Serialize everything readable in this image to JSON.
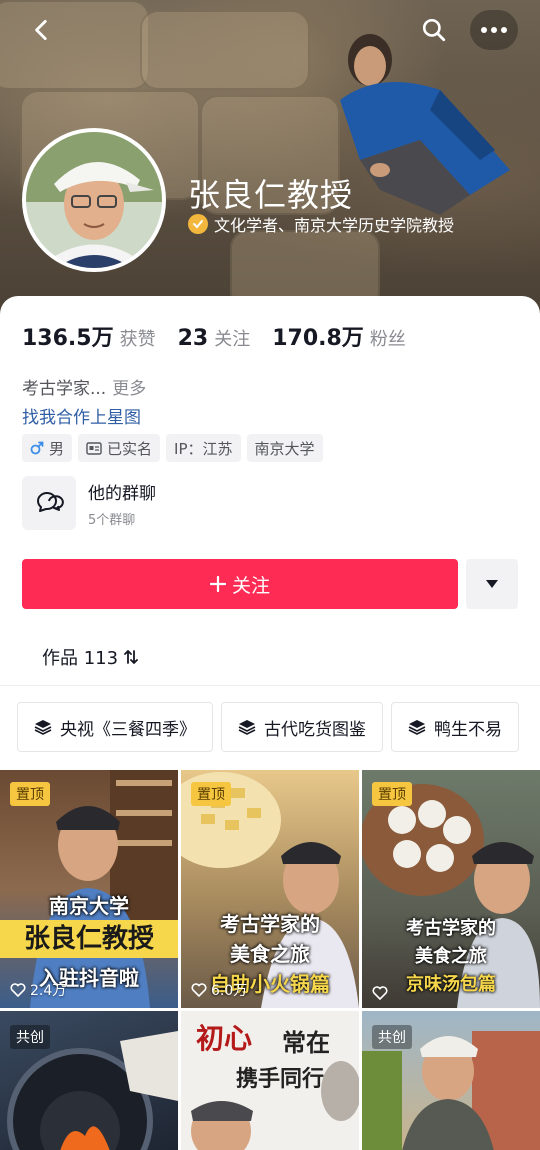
{
  "header": {
    "back_icon": "chevron-left-icon",
    "search_icon": "search-icon",
    "more_icon": "more-dots-icon"
  },
  "profile": {
    "name": "张良仁教授",
    "verification": "文化学者、南京大学历史学院教授",
    "stats": [
      {
        "value": "136.5万",
        "label": "获赞"
      },
      {
        "value": "23",
        "label": "关注"
      },
      {
        "value": "170.8万",
        "label": "粉丝"
      }
    ],
    "bio": "考古学家...",
    "bio_more": "更多",
    "bio_link": "找我合作上星图",
    "tags": [
      {
        "icon": "male-icon",
        "label": "男"
      },
      {
        "icon": "id-card-icon",
        "label": "已实名"
      },
      {
        "icon": "",
        "label": "IP：江苏"
      },
      {
        "icon": "",
        "label": "南京大学"
      }
    ],
    "group_chat": {
      "title": "他的群聊",
      "subtitle": "5个群聊"
    },
    "follow_button": "关注",
    "accent_color": "#fe2c55"
  },
  "tabs": {
    "works_label": "作品 113"
  },
  "collections": [
    {
      "label": "央视《三餐四季》"
    },
    {
      "label": "古代吃货图鉴"
    },
    {
      "label": "鸭生不易"
    }
  ],
  "videos": [
    {
      "badge": "置顶",
      "caption_lines": [
        "南京大学",
        "张良仁教授",
        "入驻抖音啦"
      ],
      "likes": "2.4万"
    },
    {
      "badge": "置顶",
      "caption_lines": [
        "考古学家的",
        "美食之旅",
        "自助小火锅篇"
      ],
      "likes": "6.0万"
    },
    {
      "badge": "置顶",
      "caption_lines": [
        "考古学家的",
        "美食之旅",
        "京味汤包篇"
      ],
      "likes": ""
    },
    {
      "badge": "共创",
      "caption_lines": [],
      "likes": ""
    },
    {
      "badge": "",
      "caption_lines": [
        "初心",
        "常在",
        "携手同行"
      ],
      "likes": ""
    },
    {
      "badge": "共创",
      "caption_lines": [],
      "likes": ""
    }
  ]
}
